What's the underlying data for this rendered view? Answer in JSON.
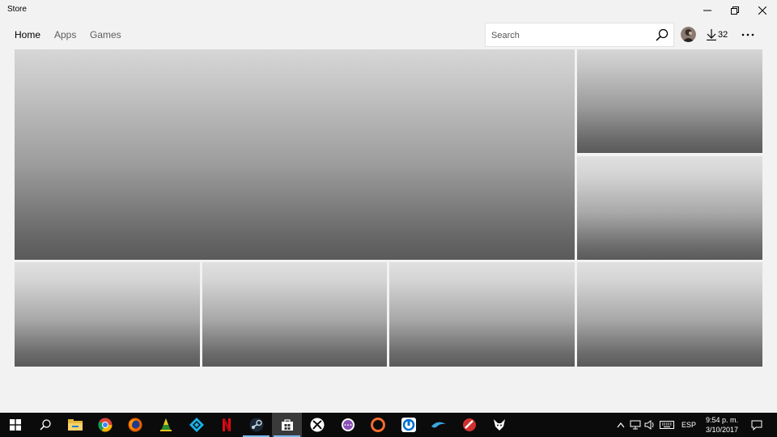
{
  "window": {
    "title": "Store",
    "controls": [
      "minimize-icon",
      "restore-icon",
      "close-icon"
    ]
  },
  "nav": {
    "tabs": [
      {
        "label": "Home",
        "active": true
      },
      {
        "label": "Apps",
        "active": false
      },
      {
        "label": "Games",
        "active": false
      }
    ]
  },
  "search": {
    "placeholder": "Search",
    "icon": "search-icon"
  },
  "header": {
    "avatar_icon": "avatar",
    "downloads_count": "32",
    "downloads_icon": "download-icon",
    "more_icon": "more-icon"
  },
  "tiles": {
    "hero": "hero-tile",
    "side": [
      "side-tile-top",
      "side-tile-bottom"
    ],
    "row": [
      "row-tile-1",
      "row-tile-2",
      "row-tile-3",
      "row-tile-4"
    ]
  },
  "taskbar": {
    "apps": [
      "windows-start-icon",
      "search-icon",
      "file-explorer-icon",
      "chrome-icon",
      "firefox-icon",
      "vlc-cone-icon",
      "kodi-icon",
      "netflix-icon",
      "steam-icon",
      "store-icon",
      "xbox-icon",
      "uplay-icon",
      "origin-icon",
      "uplay-blue-icon",
      "dolphin-icon",
      "game-icon",
      "wolf-icon"
    ],
    "tray": {
      "language": "ESP",
      "time": "9:54 p. m.",
      "date": "3/10/2017"
    }
  },
  "colors": {
    "window_bg": "#f2f2f2",
    "taskbar_bg": "#0b0b0b",
    "accent": "#76b9ed"
  }
}
